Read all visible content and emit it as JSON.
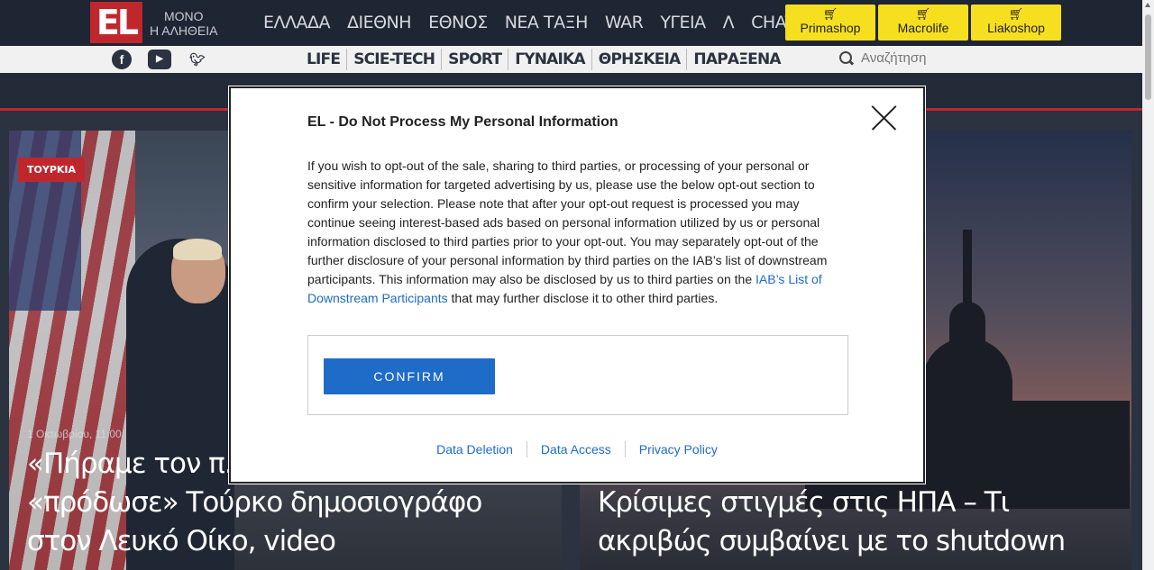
{
  "header": {
    "logo": "EL",
    "tagline_line1": "ΜΟΝΟ",
    "tagline_line2": "Η ΑΛΗΘΕΙΑ",
    "nav": [
      "ΕΛΛΑΔΑ",
      "ΔΙΕΘΝΗ",
      "ΕΘΝΟΣ",
      "ΝΕΑ ΤΑΞΗ",
      "WAR",
      "ΥΓΕΙΑ",
      "Λ",
      "CHAT"
    ],
    "shops": [
      "Primashop",
      "Macrolife",
      "Liakoshop"
    ]
  },
  "subbar": {
    "social": [
      "facebook-icon",
      "youtube-icon",
      "twitter-icon"
    ],
    "nav": [
      "LIFE",
      "SCIE-TECH",
      "SPORT",
      "ΓΥΝΑΙΚΑ",
      "ΘΡΗΣΚΕΙΑ",
      "ΠΑΡΑΞΕΝΑ"
    ],
    "search_placeholder": "Αναζήτηση"
  },
  "articles": [
    {
      "tag": "ΤΟΥΡΚΙΑ",
      "date": "1 Οκτωβρίου, 11:00",
      "headline": "«Πήραμε τον π... μικρόφωνο που «πρόδωσε» Τούρκο δημοσιογράφο στον Λευκό Οίκο, video"
    },
    {
      "headline": "Κρίσιμες στιγμές στις ΗΠΑ – Τι ακριβώς συμβαίνει με το shutdown"
    }
  ],
  "modal": {
    "title": "EL - Do Not Process My Personal Information",
    "body": "If you wish to opt-out of the sale, sharing to third parties, or processing of your personal or sensitive information for targeted advertising by us, please use the below opt-out section to confirm your selection. Please note that after your opt-out request is processed you may continue seeing interest-based ads based on personal information utilized by us or personal information disclosed to third parties prior to your opt-out. You may separately opt-out of the further disclosure of your personal information by third parties on the IAB’s list of downstream participants. This information may also be disclosed by us to third parties on the ",
    "link_text": "IAB’s List of Downstream Participants",
    "body_end": " that may further disclose it to other third parties.",
    "confirm_label": "CONFIRM",
    "footer_links": [
      "Data Deletion",
      "Data Access",
      "Privacy Policy"
    ]
  },
  "colors": {
    "accent": "#c0272d",
    "link": "#1f6bc8",
    "shop_button": "#f6df1f"
  }
}
